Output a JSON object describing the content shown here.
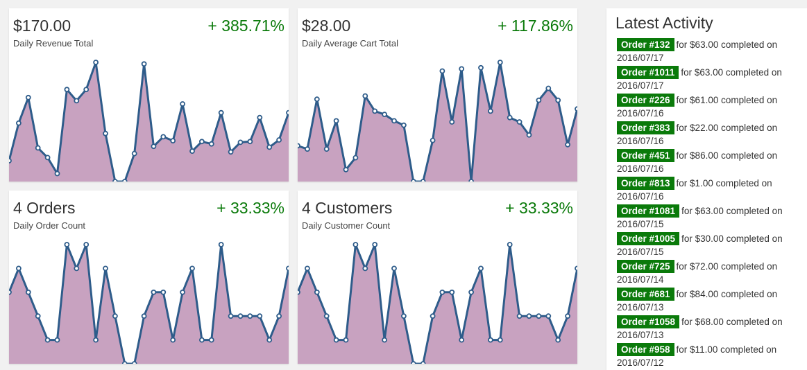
{
  "colors": {
    "positive": "#0a7a0a",
    "line": "#2e5c8a",
    "fill": "#c8a2c0",
    "badge": "#0a7a0a"
  },
  "cards": [
    {
      "value": "$170.00",
      "change": "+ 385.71%",
      "label": "Daily Revenue Total",
      "chart_data": {
        "type": "area",
        "series": [
          {
            "values": [
              16,
              63,
              95,
              32,
              20,
              0,
              105,
              91,
              105,
              139,
              50,
              -10,
              -10,
              25,
              137,
              34,
              46,
              41,
              87,
              28,
              40,
              37,
              76,
              27,
              39,
              40,
              70,
              33,
              42,
              76
            ]
          }
        ],
        "ylim": [
          -10,
          139
        ]
      }
    },
    {
      "value": "$28.00",
      "change": "+ 117.86%",
      "label": "Daily Average Cart Total",
      "chart_data": {
        "type": "area",
        "series": [
          {
            "values": [
              30,
              27,
              73,
              27,
              53,
              8,
              19,
              76,
              62,
              59,
              53,
              49,
              -3,
              -3,
              35,
              99,
              52,
              101,
              -3,
              102,
              62,
              107,
              56,
              52,
              40,
              72,
              83,
              72,
              31,
              64
            ]
          }
        ],
        "ylim": [
          -3,
          107
        ]
      }
    },
    {
      "value": "4 Orders",
      "change": "+ 33.33%",
      "label": "Daily Order Count",
      "chart_data": {
        "type": "area",
        "series": [
          {
            "values": [
              3,
              4,
              3,
              2,
              1,
              1,
              5,
              4,
              5,
              1,
              4,
              2,
              0,
              0,
              2,
              3,
              3,
              1,
              3,
              4,
              1,
              1,
              5,
              2,
              2,
              2,
              2,
              1,
              2,
              4
            ]
          }
        ],
        "ylim": [
          0,
          5
        ]
      }
    },
    {
      "value": "4 Customers",
      "change": "+ 33.33%",
      "label": "Daily Customer Count",
      "chart_data": {
        "type": "area",
        "series": [
          {
            "values": [
              3,
              4,
              3,
              2,
              1,
              1,
              5,
              4,
              5,
              1,
              4,
              2,
              0,
              0,
              2,
              3,
              3,
              1,
              3,
              4,
              1,
              1,
              5,
              2,
              2,
              2,
              2,
              1,
              2,
              4
            ]
          }
        ],
        "ylim": [
          0,
          5
        ]
      }
    }
  ],
  "activity": {
    "title": "Latest Activity",
    "items": [
      {
        "order": "Order #132",
        "text": "for $63.00 completed on 2016/07/17"
      },
      {
        "order": "Order #1011",
        "text": "for $63.00 completed on 2016/07/17"
      },
      {
        "order": "Order #226",
        "text": "for $61.00 completed on 2016/07/16"
      },
      {
        "order": "Order #383",
        "text": "for $22.00 completed on 2016/07/16"
      },
      {
        "order": "Order #451",
        "text": "for $86.00 completed on 2016/07/16"
      },
      {
        "order": "Order #813",
        "text": "for $1.00 completed on 2016/07/16"
      },
      {
        "order": "Order #1081",
        "text": "for $63.00 completed on 2016/07/15"
      },
      {
        "order": "Order #1005",
        "text": "for $30.00 completed on 2016/07/15"
      },
      {
        "order": "Order #725",
        "text": "for $72.00 completed on 2016/07/14"
      },
      {
        "order": "Order #681",
        "text": "for $84.00 completed on 2016/07/13"
      },
      {
        "order": "Order #1058",
        "text": "for $68.00 completed on 2016/07/13"
      },
      {
        "order": "Order #958",
        "text": "for $11.00 completed on 2016/07/12"
      }
    ]
  }
}
